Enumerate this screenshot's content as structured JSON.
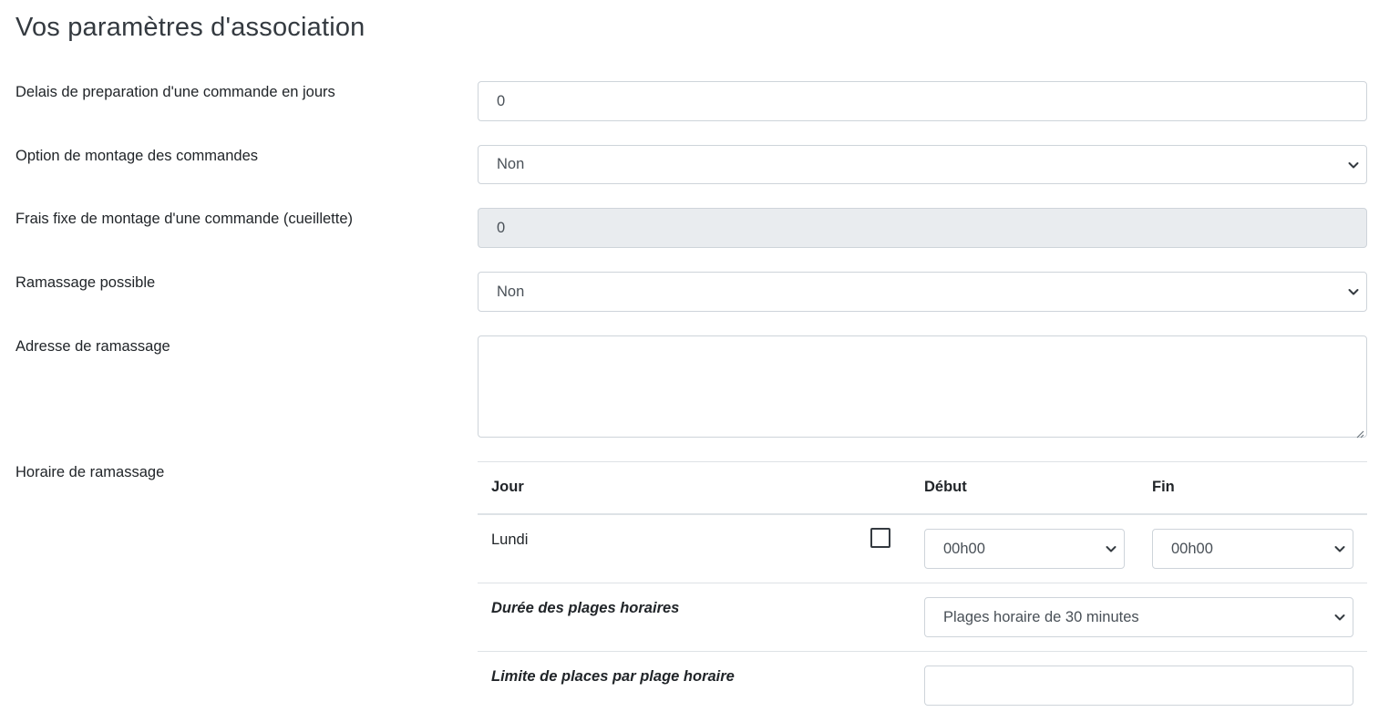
{
  "page": {
    "title": "Vos paramètres d'association"
  },
  "fields": {
    "delai": {
      "label": "Delais de preparation d'une commande en jours",
      "value": "0"
    },
    "montage_option": {
      "label": "Option de montage des commandes",
      "value": "Non"
    },
    "frais_montage": {
      "label": "Frais fixe de montage d'une commande (cueillette)",
      "value": "0"
    },
    "ramassage_possible": {
      "label": "Ramassage possible",
      "value": "Non"
    },
    "adresse_ramassage": {
      "label": "Adresse de ramassage",
      "value": ""
    },
    "horaire_ramassage": {
      "label": "Horaire de ramassage"
    }
  },
  "schedule": {
    "headers": {
      "jour": "Jour",
      "debut": "Début",
      "fin": "Fin"
    },
    "rows": [
      {
        "day": "Lundi",
        "checked": false,
        "start": "00h00",
        "end": "00h00"
      }
    ],
    "duree": {
      "label": "Durée des plages horaires",
      "value": "Plages horaire de 30 minutes"
    },
    "limite": {
      "label": "Limite de places par plage horaire",
      "value": ""
    }
  },
  "icons": {
    "select_arrow": "chevron-down-icon",
    "resize": "resize-grip-icon"
  }
}
